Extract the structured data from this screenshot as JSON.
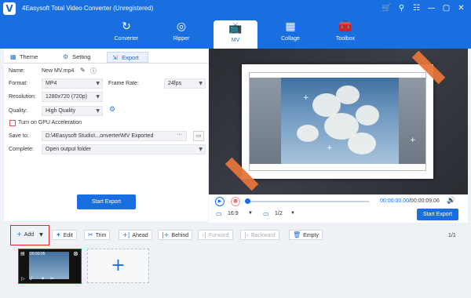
{
  "app": {
    "title": "4Easysoft Total Video Converter (Unregistered)",
    "logo_letter": "V",
    "window_controls": [
      "🛒",
      "⚲",
      "☷",
      "—",
      "▢",
      "✕"
    ]
  },
  "nav": {
    "tabs": [
      {
        "label": "Converter",
        "icon": "↻"
      },
      {
        "label": "Ripper",
        "icon": "◎"
      },
      {
        "label": "MV",
        "icon": "📺"
      },
      {
        "label": "Collage",
        "icon": "▦"
      },
      {
        "label": "Toolbox",
        "icon": "🧰"
      }
    ],
    "active": "MV"
  },
  "settings": {
    "subtabs": [
      {
        "label": "Theme",
        "icon": "▦"
      },
      {
        "label": "Setting",
        "icon": "⚙"
      },
      {
        "label": "Export",
        "icon": "⇲"
      }
    ],
    "active_subtab": "Export",
    "name_label": "Name:",
    "name_value": "New MV.mp4",
    "format_label": "Format:",
    "format_value": "MP4",
    "frame_rate_label": "Frame Rate:",
    "frame_rate_value": "24fps",
    "resolution_label": "Resolution:",
    "resolution_value": "1280x720 (720p)",
    "quality_label": "Quality:",
    "quality_value": "High Quality",
    "gpu_label": "Turn on GPU Acceleration",
    "gpu_checked": false,
    "save_to_label": "Save to:",
    "save_to_value": "D:\\4Easysoft Studio\\...onverter\\MV Exported",
    "save_to_more": "···",
    "complete_label": "Complete:",
    "complete_value": "Open output folder",
    "start_export": "Start Export"
  },
  "player": {
    "current_time": "00:00:00.00",
    "total_time": "/00:00:09.06",
    "aspect": "16:9",
    "split": "1/2",
    "start_export": "Start Export"
  },
  "toolbar": {
    "add": "Add",
    "edit": "Edit",
    "trim": "Trim",
    "ahead": "Ahead",
    "behind": "Behind",
    "forward": "Forward",
    "backward": "Backward",
    "empty": "Empty",
    "page": "1/1"
  },
  "clips": [
    {
      "time": "00:00:05"
    }
  ],
  "colors": {
    "accent": "#1a6fe0",
    "highlight": "#e0252b",
    "tape": "#e5753a"
  }
}
